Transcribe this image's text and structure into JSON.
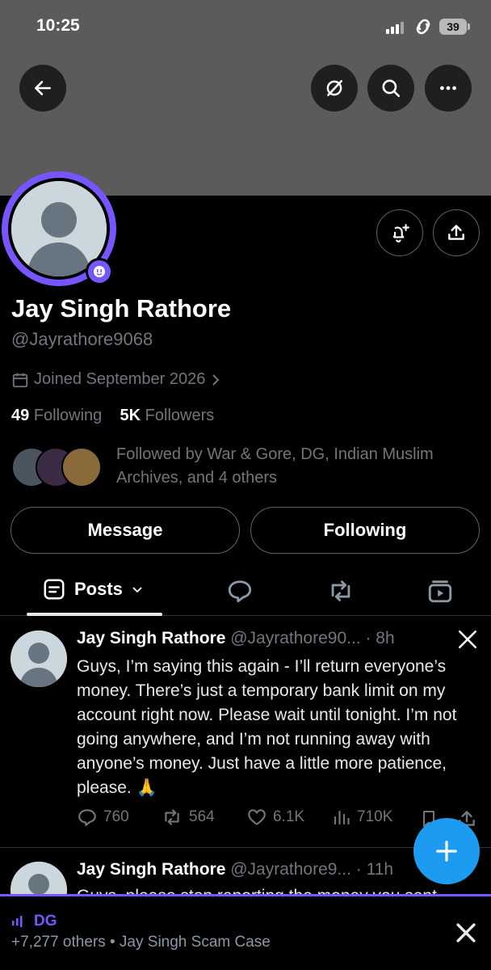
{
  "status_bar": {
    "time": "10:25",
    "battery": "39"
  },
  "header_icons": [
    "back-arrow-icon",
    "grok-icon",
    "search-icon",
    "more-icon"
  ],
  "profile": {
    "name": "Jay Singh Rathore",
    "handle": "@Jayrathore9068",
    "joined": "Joined September 2026",
    "following_count": "49",
    "following_label": "Following",
    "followers_count": "5K",
    "followers_label": "Followers",
    "followed_by": "Followed by War & Gore, DG, Indian Muslim Archives, and 4 others"
  },
  "buttons": {
    "message": "Message",
    "following": "Following"
  },
  "tabs": {
    "posts": "Posts"
  },
  "posts": [
    {
      "name": "Jay Singh Rathore",
      "handle_time": "@Jayrathore90... · 8h",
      "text": "Guys, I’m saying this again - I’ll return everyone’s money. There’s just a temporary bank limit on my account right now. Please wait until tonight. I’m not going anywhere, and I’m not running away with anyone’s money. Just have a little more patience, please. 🙏",
      "replies": "760",
      "reposts": "564",
      "likes": "6.1K",
      "views": "710K"
    },
    {
      "name": "Jay Singh Rathore",
      "handle_time": "@Jayrathore9... · 11h",
      "text_partial": "Guys, please stop reporting the money you sent"
    }
  ],
  "spaces_bar": {
    "host": "DG",
    "subtitle": "+7,277 others • Jay Singh Scam Case"
  },
  "colors": {
    "accent": "#7856ff",
    "blue": "#1d9bf0",
    "muted": "#71767b",
    "banner": "#5b5b5b"
  }
}
